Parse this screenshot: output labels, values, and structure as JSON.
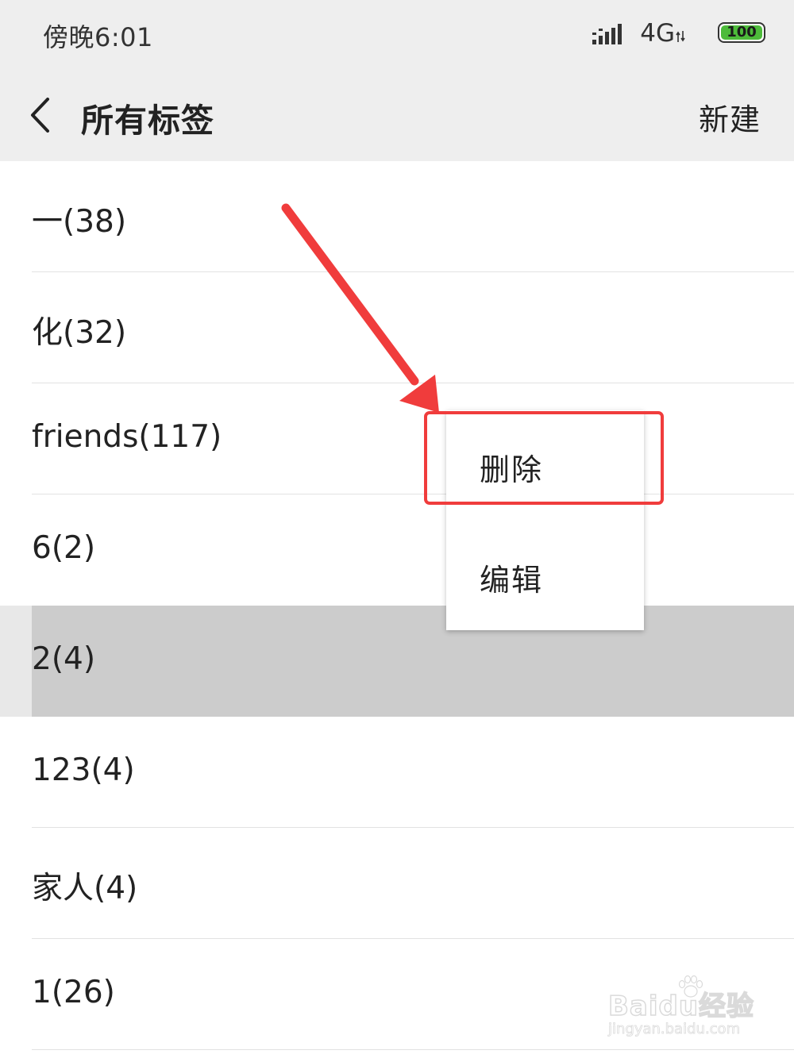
{
  "status_bar": {
    "time": "傍晚6:01",
    "network": "4G",
    "battery": "100",
    "icons": [
      "signal-icon",
      "network-arrows-icon",
      "battery-icon"
    ]
  },
  "nav": {
    "title": "所有标签",
    "new_label": "新建",
    "back_icon": "chevron-left-icon"
  },
  "tags": [
    {
      "label": "一(38)"
    },
    {
      "label": "化(32)"
    },
    {
      "label": "friends(117)"
    },
    {
      "label": "6(2)"
    },
    {
      "label": "2(4)",
      "selected": true
    },
    {
      "label": "123(4)"
    },
    {
      "label": "家人(4)"
    },
    {
      "label": "1(26)"
    }
  ],
  "context_menu": {
    "items": [
      {
        "label": "删除"
      },
      {
        "label": "编辑"
      }
    ]
  },
  "annotation": {
    "color": "#f03c3c"
  },
  "watermark": {
    "main": "Baidu经验",
    "sub": "jingyan.baidu.com"
  },
  "colors": {
    "header_bg": "#eeeeee",
    "selected_row_bg": "#cccccc",
    "battery_green": "#4dbb3a"
  }
}
